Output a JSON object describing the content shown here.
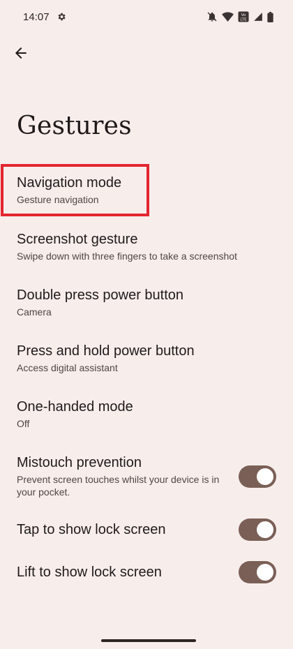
{
  "status_bar": {
    "time": "14:07",
    "icons": [
      "gear-icon",
      "mute-icon",
      "wifi-icon",
      "volte-icon",
      "signal-icon",
      "battery-icon"
    ],
    "volte_label": "Vo LTE"
  },
  "header": {
    "back_icon": "arrow-left-icon",
    "title": "Gestures"
  },
  "settings": [
    {
      "title": "Navigation mode",
      "summary": "Gesture navigation"
    },
    {
      "title": "Screenshot gesture",
      "summary": "Swipe down with three fingers to take a screenshot"
    },
    {
      "title": "Double press power button",
      "summary": "Camera"
    },
    {
      "title": "Press and hold power button",
      "summary": "Access digital assistant"
    },
    {
      "title": "One-handed mode",
      "summary": "Off"
    }
  ],
  "toggles": [
    {
      "title": "Mistouch prevention",
      "summary": "Prevent screen touches whilst your device is in your pocket.",
      "on": true
    },
    {
      "title": "Tap to show lock screen",
      "on": true
    },
    {
      "title": "Lift to show lock screen",
      "on": true
    }
  ],
  "colors": {
    "background": "#f7eeec",
    "toggle_on": "#7a5f56",
    "highlight": "#e3262f"
  }
}
